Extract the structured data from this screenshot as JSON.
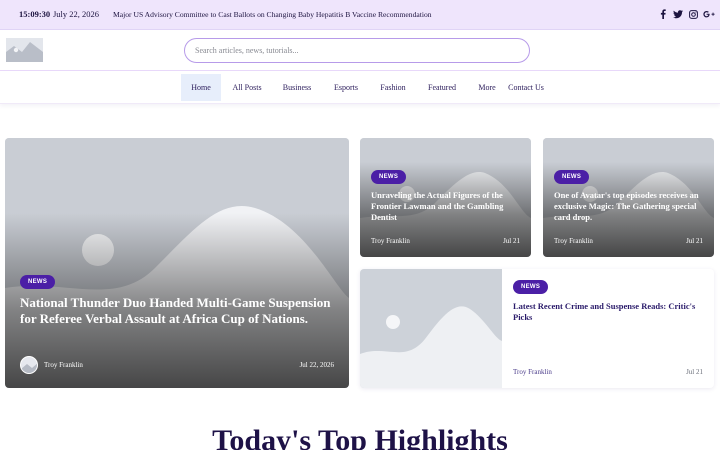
{
  "topbar": {
    "time": "15:09:30",
    "date": "July 22, 2026",
    "headline": "Major US Advisory Committee to Cast Ballots on Changing Baby Hepatitis B Vaccine Recommendation",
    "social_icons": [
      "facebook-icon",
      "twitter-icon",
      "instagram-icon",
      "google-plus-icon"
    ]
  },
  "header": {
    "search_placeholder": "Search articles, news, tutorials..."
  },
  "nav": {
    "items": [
      "Home",
      "All Posts",
      "Business",
      "Esports",
      "Fashion",
      "Featured",
      "More",
      "Contact Us"
    ],
    "active": "Home"
  },
  "featured": {
    "category": "NEWS",
    "title": "National Thunder Duo Handed Multi-Game Suspension for Referee Verbal Assault at Africa Cup of Nations.",
    "author": "Troy Franklin",
    "date": "Jul 22, 2026"
  },
  "side_cards": [
    {
      "category": "NEWS",
      "title": "Unraveling the Actual Figures of the Frontier Lawman and the Gambling Dentist",
      "author": "Troy Franklin",
      "date": "Jul 21"
    },
    {
      "category": "NEWS",
      "title": "One of Avatar's top episodes receives an exclusive Magic: The Gathering special card drop.",
      "author": "Troy Franklin",
      "date": "Jul 21"
    },
    {
      "category": "NEWS",
      "title": "Latest Recent Crime and Suspense Reads: Critic's Picks",
      "author": "Troy Franklin",
      "date": "Jul 21"
    }
  ],
  "section": {
    "title": "Today's Top Highlights"
  },
  "colors": {
    "topbar_bg": "#efe5fc",
    "accent": "#4b1fa6",
    "title_dark": "#1e1247",
    "nav_active_bg": "#e7eefb"
  }
}
